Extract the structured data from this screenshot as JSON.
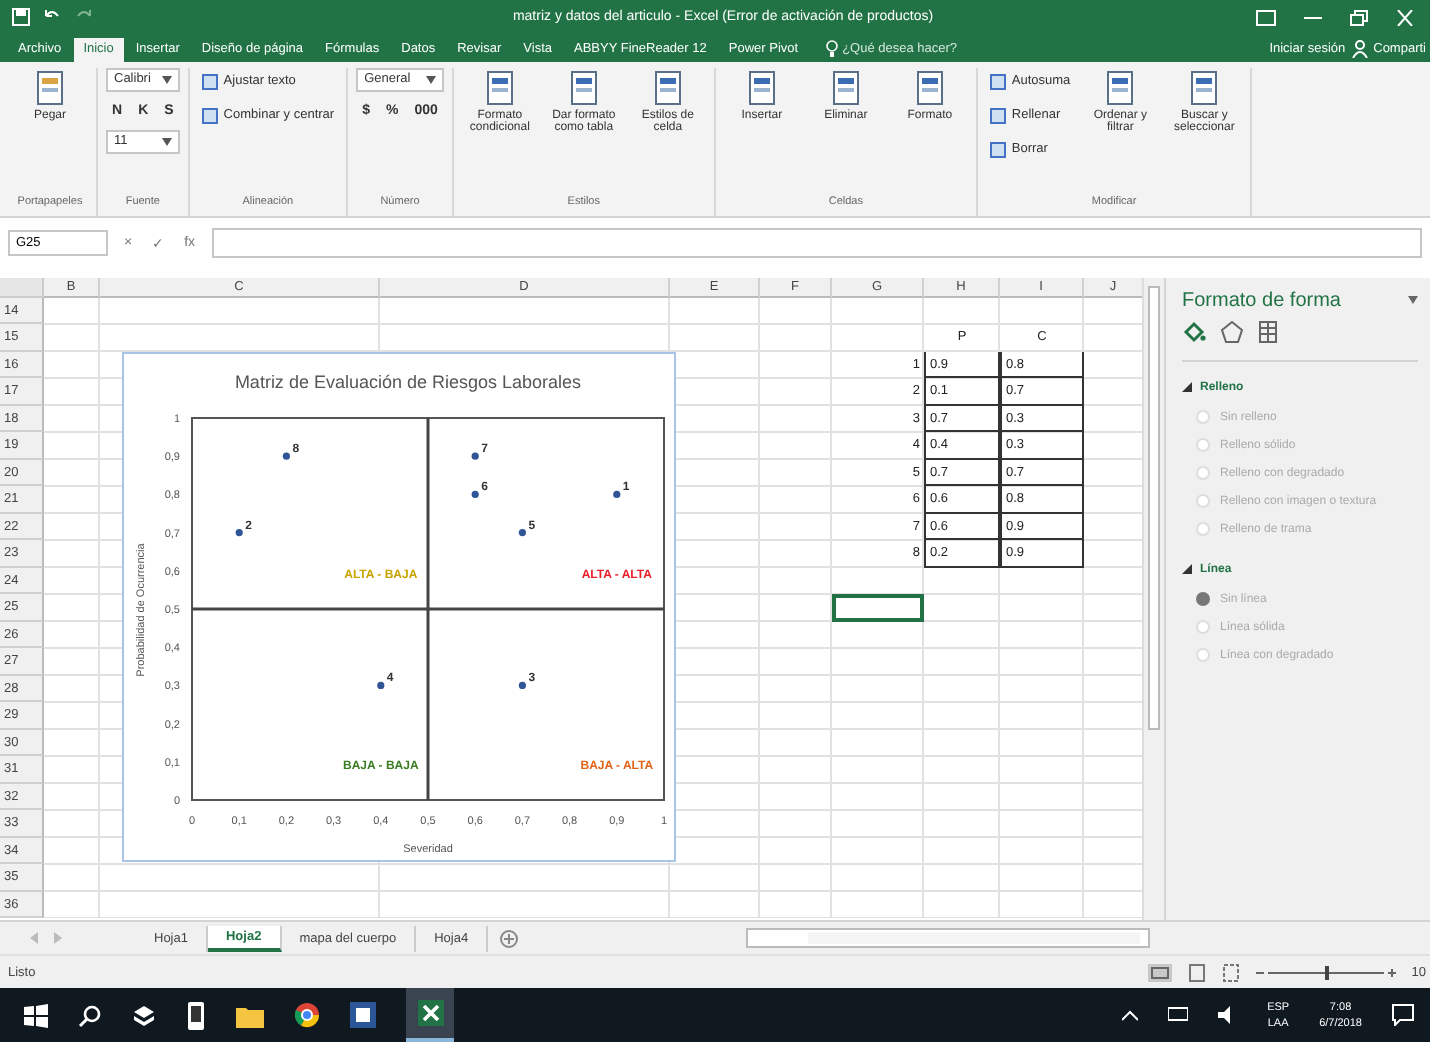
{
  "window": {
    "title": "matriz y datos del articulo - Excel (Error de activación de productos)"
  },
  "ribbon_tabs": [
    {
      "label": "Archivo",
      "selected": false
    },
    {
      "label": "Inicio",
      "selected": true
    },
    {
      "label": "Insertar",
      "selected": false
    },
    {
      "label": "Diseño de página",
      "selected": false
    },
    {
      "label": "Fórmulas",
      "selected": false
    },
    {
      "label": "Datos",
      "selected": false
    },
    {
      "label": "Revisar",
      "selected": false
    },
    {
      "label": "Vista",
      "selected": false
    },
    {
      "label": "ABBYY FineReader 12",
      "selected": false
    },
    {
      "label": "Power Pivot",
      "selected": false
    }
  ],
  "search_hint": "¿Qué desea hacer?",
  "account": {
    "sign_in": "Iniciar sesión",
    "share": "Comparti"
  },
  "ribbon_groups": [
    {
      "label": "Portapapeles",
      "items": [
        {
          "kind": "big",
          "label": "Pegar"
        }
      ]
    },
    {
      "label": "Fuente",
      "items": [
        {
          "kind": "field",
          "label": "Calibri"
        },
        {
          "kind": "glyphs",
          "glyphs": [
            "N",
            "K",
            "S"
          ]
        },
        {
          "kind": "field",
          "label": "11"
        }
      ]
    },
    {
      "label": "Alineación",
      "items": [
        {
          "kind": "small",
          "label": "Ajustar texto"
        },
        {
          "kind": "small",
          "label": "Combinar y centrar"
        }
      ]
    },
    {
      "label": "Número",
      "items": [
        {
          "kind": "field",
          "label": "General"
        },
        {
          "kind": "glyphs",
          "glyphs": [
            "$",
            "%",
            "000"
          ]
        }
      ]
    },
    {
      "label": "Estilos",
      "items": [
        {
          "kind": "big",
          "label": "Formato condicional"
        },
        {
          "kind": "big",
          "label": "Dar formato como tabla"
        },
        {
          "kind": "big",
          "label": "Estilos de celda"
        }
      ]
    },
    {
      "label": "Celdas",
      "items": [
        {
          "kind": "big",
          "label": "Insertar"
        },
        {
          "kind": "big",
          "label": "Eliminar"
        },
        {
          "kind": "big",
          "label": "Formato"
        }
      ]
    },
    {
      "label": "Modificar",
      "items": [
        {
          "kind": "small",
          "label": "Autosuma"
        },
        {
          "kind": "small",
          "label": "Rellenar"
        },
        {
          "kind": "small",
          "label": "Borrar"
        },
        {
          "kind": "big",
          "label": "Ordenar y filtrar"
        },
        {
          "kind": "big",
          "label": "Buscar y seleccionar"
        }
      ]
    }
  ],
  "formula_bar": {
    "name_box": "G25",
    "buttons": [
      "×",
      "✓",
      "fx"
    ]
  },
  "grid": {
    "columns": [
      "B",
      "C",
      "D",
      "E",
      "F",
      "G",
      "H",
      "I",
      "J"
    ],
    "rows": [
      {
        "number": "14",
        "cells": {}
      },
      {
        "number": "15",
        "kind": "header",
        "cells": {
          "H": "P",
          "I": "C"
        }
      },
      {
        "number": "16",
        "kind": "data",
        "cells": {
          "G": "1",
          "H": "0.9",
          "I": "0.8"
        }
      },
      {
        "number": "17",
        "kind": "data",
        "cells": {
          "G": "2",
          "H": "0.1",
          "I": "0.7"
        }
      },
      {
        "number": "18",
        "kind": "data",
        "cells": {
          "G": "3",
          "H": "0.7",
          "I": "0.3"
        }
      },
      {
        "number": "19",
        "kind": "data",
        "cells": {
          "G": "4",
          "H": "0.4",
          "I": "0.3"
        }
      },
      {
        "number": "20",
        "kind": "data",
        "cells": {
          "G": "5",
          "H": "0.7",
          "I": "0.7"
        }
      },
      {
        "number": "21",
        "kind": "data",
        "cells": {
          "G": "6",
          "H": "0.6",
          "I": "0.8"
        }
      },
      {
        "number": "22",
        "kind": "data",
        "cells": {
          "G": "7",
          "H": "0.6",
          "I": "0.9"
        }
      },
      {
        "number": "23",
        "kind": "data",
        "cells": {
          "G": "8",
          "H": "0.2",
          "I": "0.9"
        }
      },
      {
        "number": "24",
        "cells": {}
      },
      {
        "number": "25",
        "cells": {}
      },
      {
        "number": "26",
        "cells": {}
      },
      {
        "number": "27",
        "cells": {}
      },
      {
        "number": "28",
        "cells": {}
      },
      {
        "number": "29",
        "cells": {}
      },
      {
        "number": "30",
        "cells": {}
      },
      {
        "number": "31",
        "cells": {}
      },
      {
        "number": "32",
        "cells": {}
      },
      {
        "number": "33",
        "cells": {}
      },
      {
        "number": "34",
        "cells": {}
      },
      {
        "number": "35",
        "cells": {}
      },
      {
        "number": "36",
        "cells": {}
      }
    ]
  },
  "chart": {
    "point_labels": [
      "1",
      "2",
      "3",
      "4",
      "5",
      "6",
      "7",
      "8"
    ],
    "quadrant_labels": [
      {
        "text": "ALTA - BAJA",
        "color": "#c9a400"
      },
      {
        "text": "ALTA - ALTA",
        "color": "#e8202a"
      },
      {
        "text": "BAJA - BAJA",
        "color": "#3a7d22"
      },
      {
        "text": "BAJA - ALTA",
        "color": "#e0651a"
      }
    ],
    "chart_data": {
      "type": "scatter",
      "title": "Matriz de Evaluación de Riesgos Laborales",
      "xlabel": "Severidad",
      "ylabel": "Probabilidad de Ocurrencia",
      "x": [
        0.9,
        0.1,
        0.7,
        0.4,
        0.7,
        0.6,
        0.6,
        0.2
      ],
      "values": [
        0.8,
        0.7,
        0.3,
        0.3,
        0.7,
        0.8,
        0.9,
        0.9
      ],
      "xlim": [
        0,
        1
      ],
      "ylim": [
        0,
        1
      ],
      "xticks": [
        {
          "value": 0,
          "label": "0"
        },
        {
          "value": 0.1,
          "label": "0,1"
        },
        {
          "value": 0.2,
          "label": "0,2"
        },
        {
          "value": 0.3,
          "label": "0,3"
        },
        {
          "value": 0.4,
          "label": "0,4"
        },
        {
          "value": 0.5,
          "label": "0,5"
        },
        {
          "value": 0.6,
          "label": "0,6"
        },
        {
          "value": 0.7,
          "label": "0,7"
        },
        {
          "value": 0.8,
          "label": "0,8"
        },
        {
          "value": 0.9,
          "label": "0,9"
        },
        {
          "value": 1,
          "label": "1"
        }
      ],
      "yticks": [
        {
          "value": 0,
          "label": "0"
        },
        {
          "value": 0.1,
          "label": "0,1"
        },
        {
          "value": 0.2,
          "label": "0,2"
        },
        {
          "value": 0.3,
          "label": "0,3"
        },
        {
          "value": 0.4,
          "label": "0,4"
        },
        {
          "value": 0.5,
          "label": "0,5"
        },
        {
          "value": 0.6,
          "label": "0,6"
        },
        {
          "value": 0.7,
          "label": "0,7"
        },
        {
          "value": 0.8,
          "label": "0,8"
        },
        {
          "value": 0.9,
          "label": "0,9"
        },
        {
          "value": 1,
          "label": "1"
        }
      ]
    }
  },
  "pane": {
    "title": "Formato de forma",
    "sections": [
      {
        "title": "Relleno",
        "expanded": true,
        "options": [
          {
            "label": "Sin relleno",
            "selected": false
          },
          {
            "label": "Relleno sólido",
            "selected": false
          },
          {
            "label": "Relleno con degradado",
            "selected": false
          },
          {
            "label": "Relleno con imagen o textura",
            "selected": false
          },
          {
            "label": "Relleno de trama",
            "selected": false
          }
        ]
      },
      {
        "title": "Línea",
        "expanded": true,
        "options": [
          {
            "label": "Sin línea",
            "selected": true
          },
          {
            "label": "Línea sólida",
            "selected": false
          },
          {
            "label": "Línea con degradado",
            "selected": false
          }
        ]
      }
    ]
  },
  "sheet_tabs": [
    {
      "label": "Hoja1",
      "selected": false
    },
    {
      "label": "Hoja2",
      "selected": true
    },
    {
      "label": "mapa del cuerpo",
      "selected": false
    },
    {
      "label": "Hoja4",
      "selected": false
    }
  ],
  "status_bar": {
    "text": "Listo",
    "zoom": "10",
    "zoom_slider": {
      "level": 0.5
    }
  },
  "taskbar": {
    "language": "ESP",
    "region": "LAA",
    "time": "7:08",
    "date": "6/7/2018"
  }
}
